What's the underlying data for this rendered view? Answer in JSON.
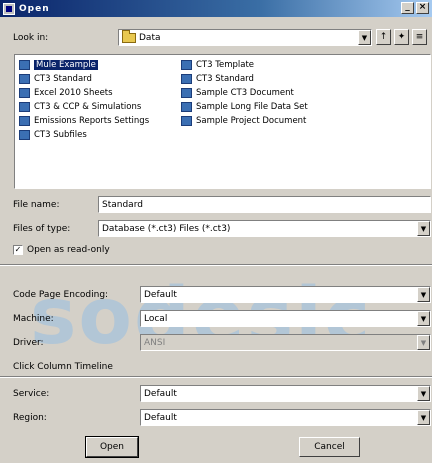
{
  "window": {
    "title": "Open",
    "minimize": "_",
    "close": "×"
  },
  "lookin": {
    "label": "Look in:",
    "value": "Data"
  },
  "files": [
    {
      "name": "Mule Example",
      "selected": true
    },
    {
      "name": "CT3 Standard"
    },
    {
      "name": "Excel 2010 Sheets"
    },
    {
      "name": "CT3 & CCP & Simulations"
    },
    {
      "name": "Emissions Reports Settings"
    },
    {
      "name": "CT3 Subfiles"
    },
    {
      "name": "CT3 Template"
    },
    {
      "name": "CT3 Standard"
    },
    {
      "name": "Sample CT3 Document"
    },
    {
      "name": "Sample Long File Data Set"
    },
    {
      "name": "Sample Project Document"
    }
  ],
  "filename": {
    "label": "File name:",
    "value": "Standard"
  },
  "filetype": {
    "label": "Files of type:",
    "value": "Database (*.ct3) Files (*.ct3)"
  },
  "readonly": {
    "label": "Open as read-only",
    "checked": "✓"
  },
  "watermark": "sodesic",
  "encoding": {
    "label": "Code Page Encoding:",
    "value": "Default"
  },
  "machine": {
    "label": "Machine:",
    "value": "Local"
  },
  "driver": {
    "label": "Driver:",
    "value": "ANSI"
  },
  "scheme": {
    "label": "Click Column Timeline"
  },
  "service": {
    "label": "Service:",
    "value": "Default"
  },
  "region": {
    "label": "Region:",
    "value": "Default"
  },
  "buttons": {
    "open": "Open",
    "cancel": "Cancel"
  },
  "colors": {
    "titlebar": "#0a246a",
    "selection": "#0a246a",
    "face": "#d4d0c8"
  }
}
